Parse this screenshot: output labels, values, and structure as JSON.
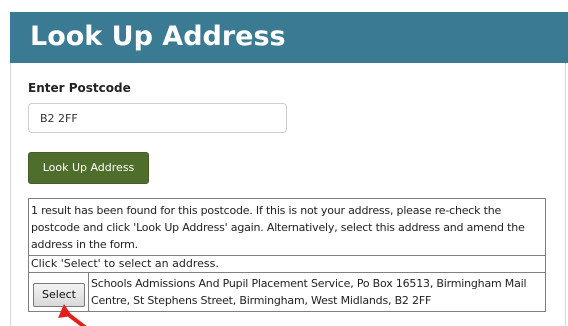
{
  "header": {
    "title": "Look Up Address"
  },
  "form": {
    "postcode_label": "Enter Postcode",
    "postcode_value": "B2 2FF",
    "lookup_button": "Look Up Address"
  },
  "results": {
    "message": "1 result has been found for this postcode. If this is not your address, please re-check the postcode and click 'Look Up Address' again. Alternatively, select this address and amend the address in the form.",
    "select_hint": "Click 'Select' to select an address.",
    "addresses": [
      {
        "select_label": "Select",
        "address": "Schools Admissions And Pupil Placement Service, Po Box 16513, Birmingham Mail Centre, St Stephens Street, Birmingham, West Midlands, B2 2FF"
      }
    ]
  },
  "colors": {
    "header_bg": "#3b7a93",
    "button_bg": "#4f6e2c",
    "arrow": "#e0201b"
  },
  "icons": {
    "pointer": "red-arrow-icon"
  }
}
